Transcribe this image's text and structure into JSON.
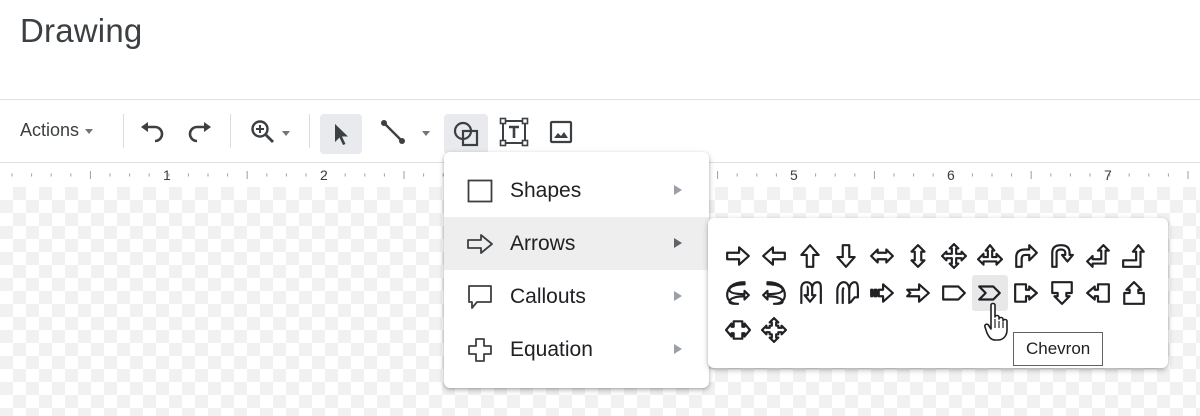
{
  "app": {
    "title": "Drawing"
  },
  "toolbar": {
    "actions_label": "Actions",
    "icons": [
      "undo-icon",
      "redo-icon",
      "zoom-icon",
      "select-icon",
      "line-icon",
      "shape-icon",
      "text-box-icon",
      "image-icon"
    ]
  },
  "ruler": {
    "numbers": [
      "1",
      "2",
      "5",
      "6",
      "7"
    ]
  },
  "menu": {
    "items": [
      {
        "label": "Shapes",
        "icon": "rectangle-icon"
      },
      {
        "label": "Arrows",
        "icon": "arrow-outline-icon"
      },
      {
        "label": "Callouts",
        "icon": "callout-icon"
      },
      {
        "label": "Equation",
        "icon": "plus-outline-icon"
      }
    ],
    "highlighted": "Arrows"
  },
  "arrows_submenu": {
    "rows": [
      [
        "right-arrow",
        "left-arrow",
        "up-arrow",
        "down-arrow",
        "left-right-arrow",
        "up-down-arrow",
        "quad-arrow",
        "left-right-up-arrow",
        "bent-arrow",
        "u-turn-arrow",
        "left-up-arrow",
        "bent-up-arrow"
      ],
      [
        "curved-right-arrow",
        "curved-left-arrow",
        "curved-up-arrow",
        "curved-down-arrow",
        "striped-right-arrow",
        "notched-right-arrow",
        "pentagon-arrow",
        "chevron-arrow",
        "right-arrow-callout",
        "down-arrow-callout",
        "left-arrow-callout",
        "up-arrow-callout"
      ],
      [
        "left-right-arrow-callout",
        "quad-arrow-callout"
      ]
    ],
    "hovered": "chevron-arrow"
  },
  "tooltip": {
    "text": "Chevron"
  },
  "colors": {
    "icon": "#3c4043",
    "menu_hover": "#eeeeee",
    "tooltip_border": "#5f6368"
  }
}
